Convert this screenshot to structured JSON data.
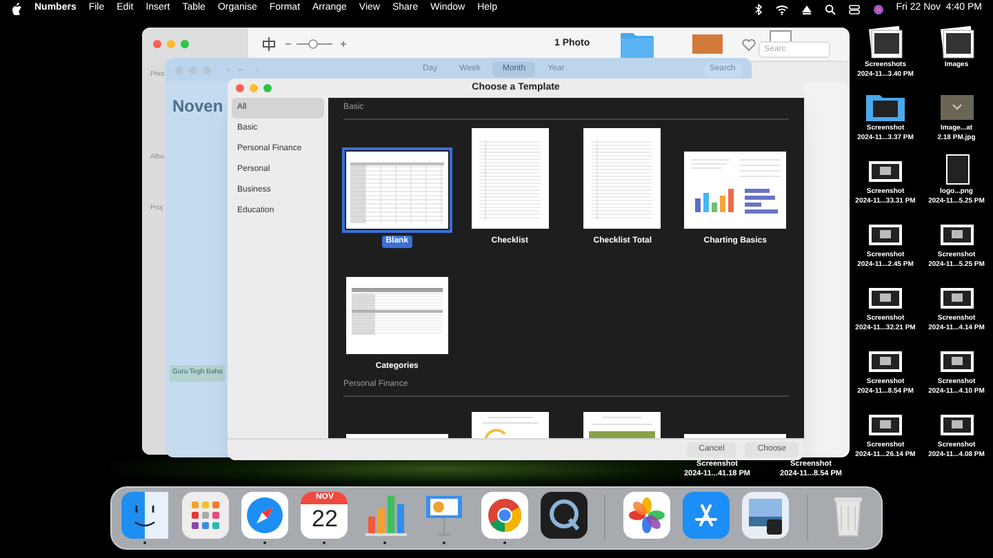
{
  "menu_bar": {
    "app": "Numbers",
    "menus": [
      "File",
      "Edit",
      "Insert",
      "Table",
      "Organise",
      "Format",
      "Arrange",
      "View",
      "Share",
      "Window",
      "Help"
    ],
    "clock": "Fri 22 Nov  4:40 PM"
  },
  "photos_window": {
    "title": "1 Photo",
    "sidebar_headings": [
      "Phot",
      "Albu",
      "Proj"
    ]
  },
  "calendar_window": {
    "views": [
      {
        "label": "Day",
        "selected": false
      },
      {
        "label": "Week",
        "selected": false
      },
      {
        "label": "Month",
        "selected": true
      },
      {
        "label": "Year",
        "selected": false
      }
    ],
    "search": {
      "placeholder": "Search"
    },
    "month_title": "Noven",
    "event": "Guru Tegh Baha"
  },
  "finder_window": {
    "search": {
      "placeholder": "Searc"
    },
    "items": [
      {
        "title": "Screenshot",
        "subtitle": "2024-11...41.18 PM"
      },
      {
        "title": "Screenshot",
        "subtitle": "2024-11...8.54 PM"
      }
    ]
  },
  "dialog": {
    "title": "Choose a Template",
    "categories": [
      {
        "label": "All",
        "selected": true
      },
      {
        "label": "Basic",
        "selected": false
      },
      {
        "label": "Personal Finance",
        "selected": false
      },
      {
        "label": "Personal",
        "selected": false
      },
      {
        "label": "Business",
        "selected": false
      },
      {
        "label": "Education",
        "selected": false
      }
    ],
    "sections": [
      {
        "title": "Basic",
        "templates": [
          {
            "name": "Blank",
            "kind": "grid",
            "selected": true
          },
          {
            "name": "Checklist",
            "kind": "list",
            "selected": false
          },
          {
            "name": "Checklist Total",
            "kind": "list",
            "selected": false
          },
          {
            "name": "Charting Basics",
            "kind": "chart",
            "selected": false
          },
          {
            "name": "Categories",
            "kind": "table",
            "selected": false
          }
        ]
      },
      {
        "title": "Personal Finance",
        "templates": [
          {
            "kind": "blankpage",
            "selected": false
          },
          {
            "kind": "budget",
            "selected": false
          },
          {
            "kind": "savings",
            "selected": false
          },
          {
            "kind": "blankpage",
            "selected": false
          }
        ]
      }
    ],
    "buttons": [
      "Cancel",
      "Choose"
    ]
  },
  "desktop_icons": [
    {
      "title": "Screenshots",
      "subtitle": "2024-11...3.40 PM",
      "kind": "stack"
    },
    {
      "title": "Images",
      "kind": "stack"
    },
    {
      "title": "Screenshot",
      "subtitle": "2024-11...3.37 PM",
      "kind": "folder"
    },
    {
      "title": "Image...at",
      "subtitle": "2.18 PM.jpg",
      "kind": "image"
    },
    {
      "title": "Screenshot",
      "subtitle": "2024-11...33.31 PM",
      "kind": "shot"
    },
    {
      "title": "logo...png",
      "subtitle": "2024-11...5.25 PM",
      "kind": "page"
    },
    {
      "title": "Screenshot",
      "subtitle": "2024-11...2.45 PM",
      "kind": "shot"
    },
    {
      "title": "Screenshot",
      "subtitle": "2024-11...5.25 PM",
      "kind": "shot"
    },
    {
      "title": "Screenshot",
      "subtitle": "2024-11...32.21 PM",
      "kind": "shot"
    },
    {
      "title": "Screenshot",
      "subtitle": "2024-11...4.14 PM",
      "kind": "shot"
    },
    {
      "title": "Screenshot",
      "subtitle": "2024-11...8.54 PM",
      "kind": "shot"
    },
    {
      "title": "Screenshot",
      "subtitle": "2024-11...4.10 PM",
      "kind": "shot"
    },
    {
      "title": "Screenshot",
      "subtitle": "2024-11...26.14 PM",
      "kind": "shot"
    },
    {
      "title": "Screenshot",
      "subtitle": "2024-11...4.08 PM",
      "kind": "shot"
    }
  ],
  "dock": {
    "items": [
      {
        "kind": "finder",
        "running": true
      },
      {
        "kind": "launchpad",
        "running": false
      },
      {
        "kind": "safari",
        "running": true
      },
      {
        "kind": "calendar",
        "running": true,
        "month": "NOV",
        "day": "22"
      },
      {
        "kind": "numbers",
        "running": true
      },
      {
        "kind": "keynote",
        "running": true
      },
      {
        "kind": "chrome",
        "running": true
      },
      {
        "kind": "quicktime",
        "running": false
      },
      {
        "kind": "separator"
      },
      {
        "kind": "photos",
        "running": false
      },
      {
        "kind": "appstore",
        "running": false
      },
      {
        "kind": "preview",
        "running": false
      },
      {
        "kind": "separator"
      },
      {
        "kind": "trash",
        "running": false
      }
    ]
  }
}
